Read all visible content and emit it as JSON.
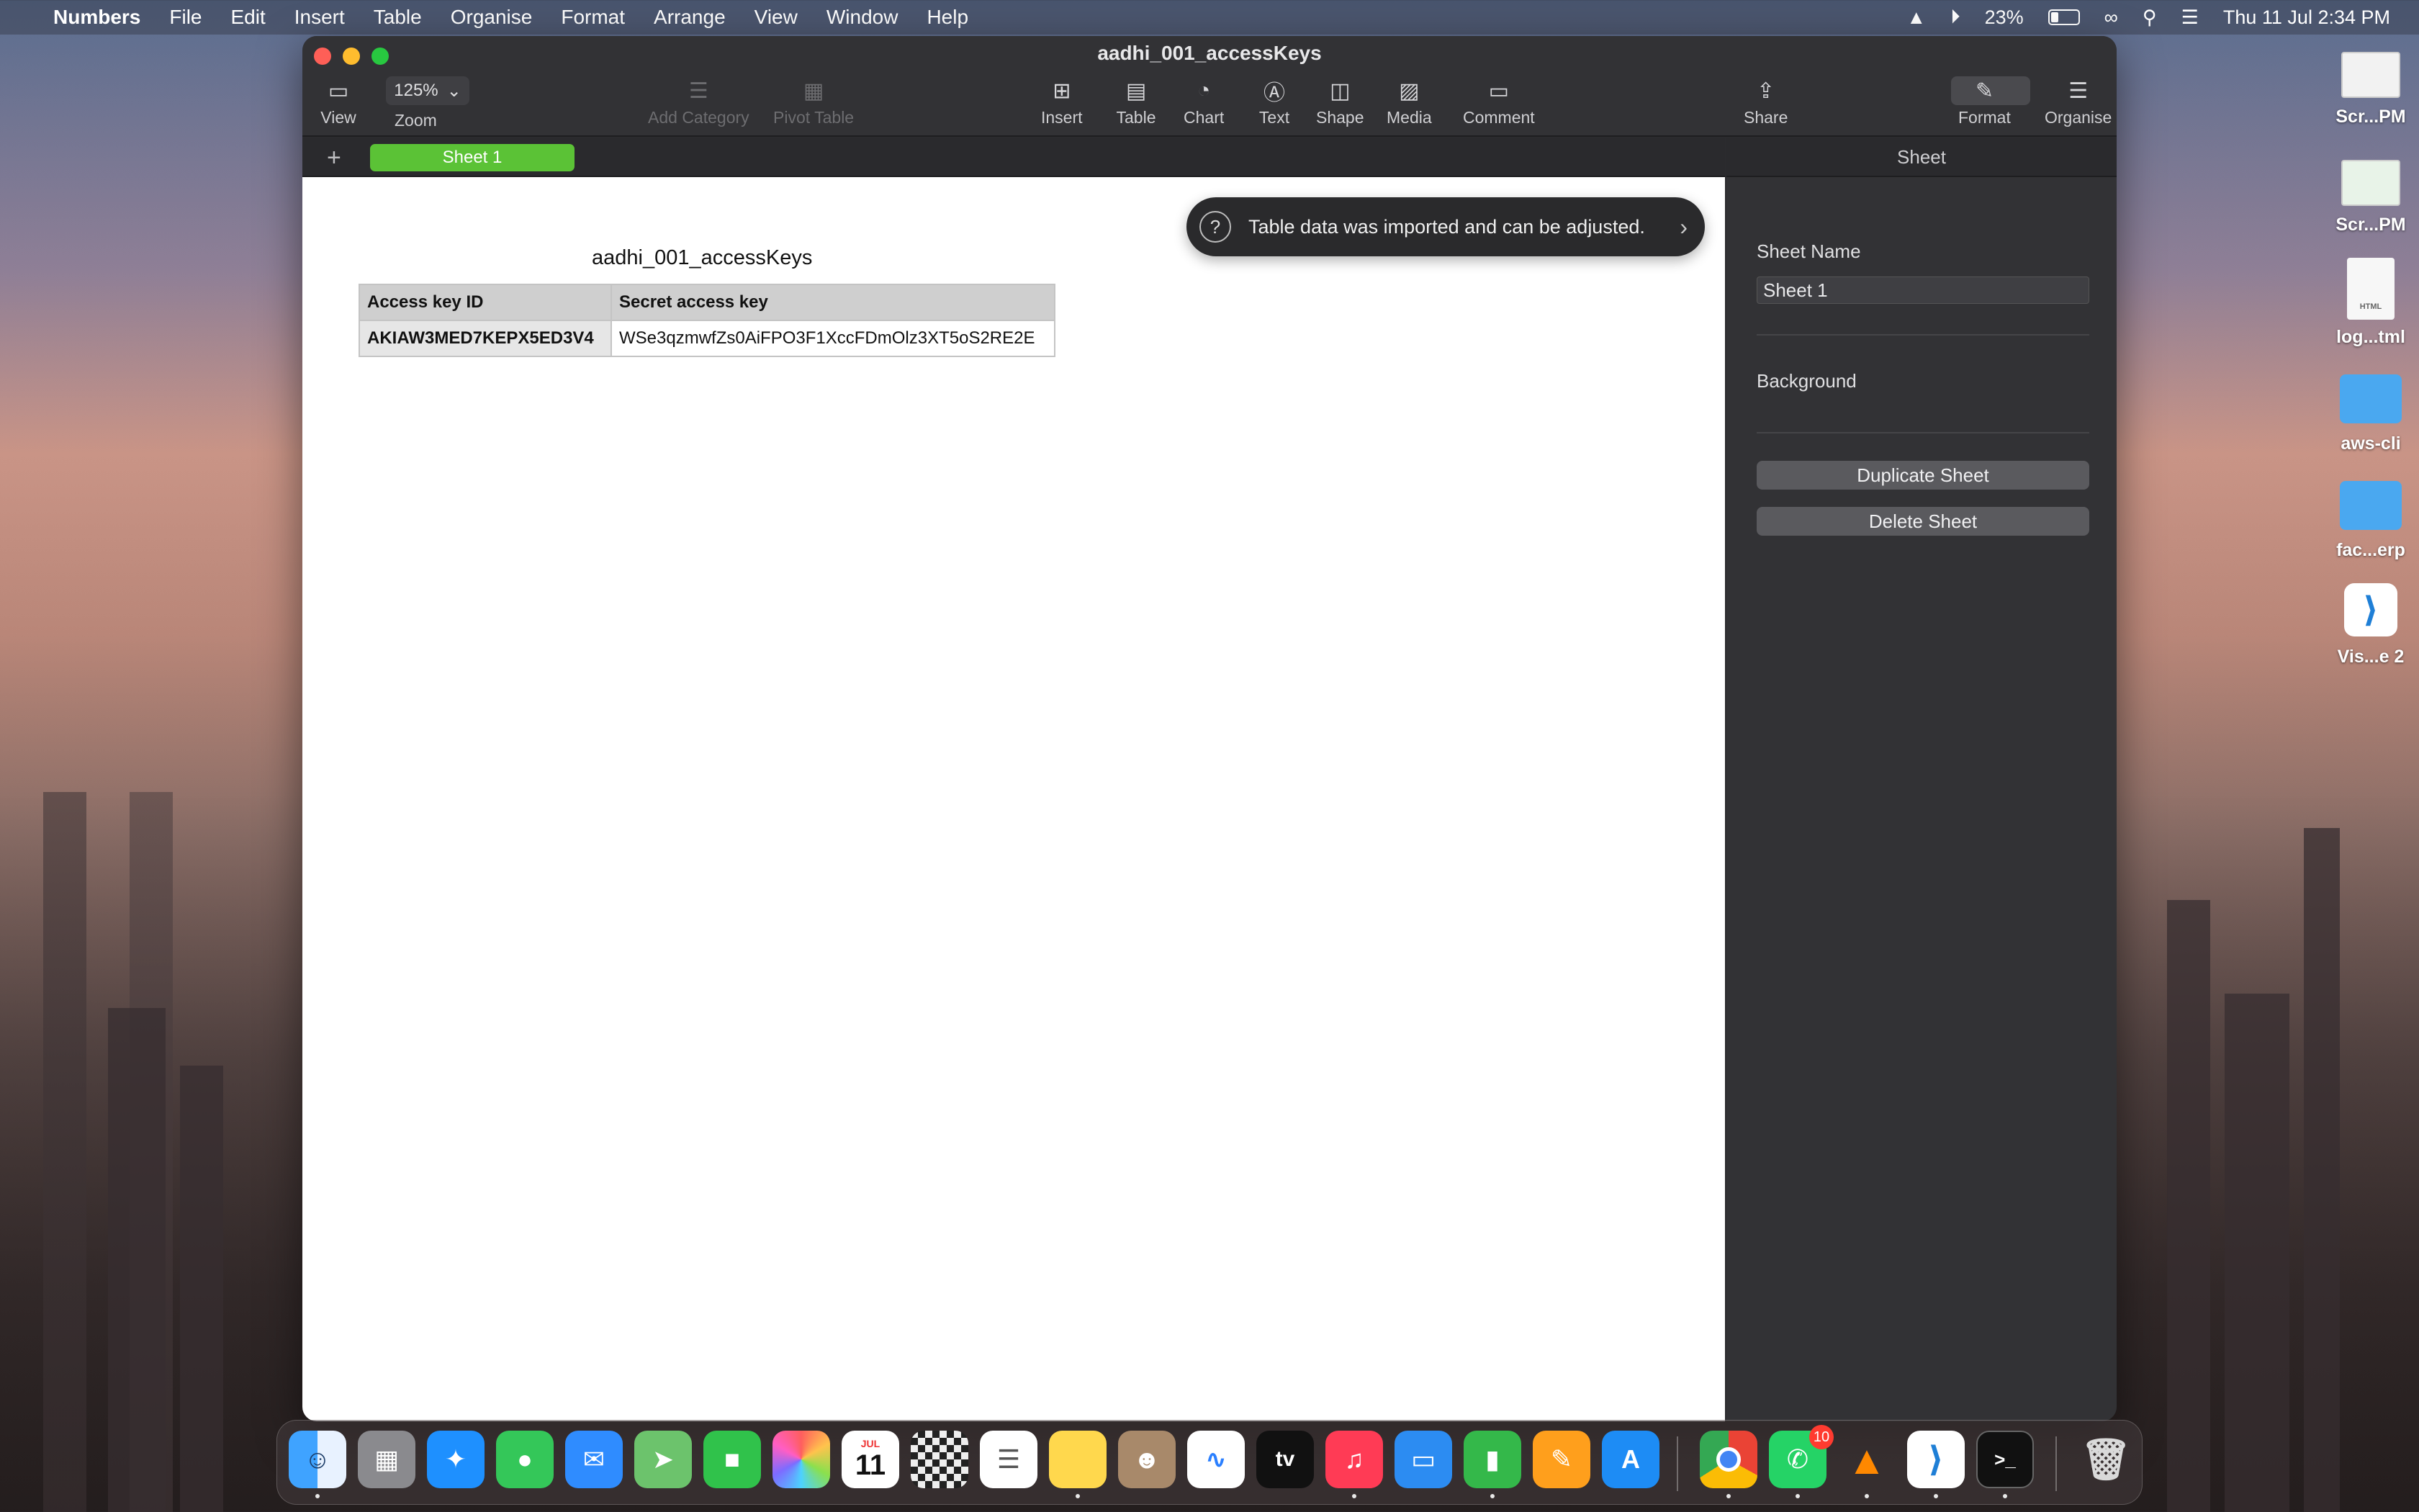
{
  "menubar": {
    "app_name": "Numbers",
    "items": [
      "File",
      "Edit",
      "Insert",
      "Table",
      "Organise",
      "Format",
      "Arrange",
      "View",
      "Window",
      "Help"
    ],
    "battery": "23%",
    "datetime": "Thu 11 Jul  2:34 PM"
  },
  "window": {
    "title": "aadhi_001_accessKeys",
    "toolbar": {
      "view": "View",
      "zoom_value": "125%",
      "zoom_label": "Zoom",
      "add_category": "Add Category",
      "pivot_table": "Pivot Table",
      "insert": "Insert",
      "table": "Table",
      "chart": "Chart",
      "text": "Text",
      "shape": "Shape",
      "media": "Media",
      "comment": "Comment",
      "share": "Share",
      "format": "Format",
      "organise": "Organise"
    },
    "tabs": {
      "add": "+",
      "active_sheet": "Sheet 1"
    }
  },
  "sheet": {
    "table_title": "aadhi_001_accessKeys",
    "columns": [
      "Access key ID",
      "Secret access key"
    ],
    "rows": [
      [
        "AKIAW3MED7KEPX5ED3V4",
        "WSe3qzmwfZs0AiFPO3F1XccFDmOlz3XT5oS2RE2E"
      ]
    ],
    "toast": "Table data was imported and can be adjusted."
  },
  "inspector": {
    "header": "Sheet",
    "sheet_name_label": "Sheet Name",
    "sheet_name_value": "Sheet 1",
    "background_label": "Background",
    "duplicate_button": "Duplicate Sheet",
    "delete_button": "Delete Sheet"
  },
  "desktop": {
    "items": [
      "Scr...PM",
      "Scr...PM",
      "log...tml",
      "aws-cli",
      "fac...erp",
      "Vis...e 2"
    ],
    "html_badge": "HTML"
  },
  "dock": {
    "calendar_month": "JUL",
    "calendar_day": "11",
    "whatsapp_badge": "10",
    "tv_label": "tv"
  },
  "colors": {
    "sheet_tab": "#5bc236",
    "table_header": "#cfcfcf",
    "badge": "#ff3b30"
  }
}
